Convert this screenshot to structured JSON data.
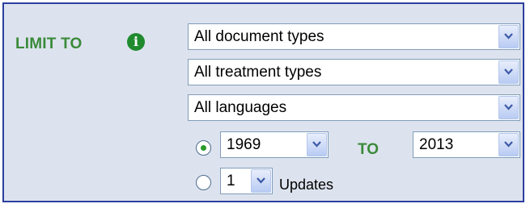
{
  "limit": {
    "label": "LIMIT TO",
    "info_icon": "info-icon",
    "info_glyph": "i"
  },
  "filters": {
    "document_type": "All document types",
    "treatment_type": "All treatment types",
    "language": "All languages"
  },
  "date_range": {
    "from_year": "1969",
    "to_label": "TO",
    "to_year": "2013",
    "selected": true
  },
  "updates": {
    "count": "1",
    "label": "Updates",
    "selected": false
  },
  "colors": {
    "accent_green": "#3a8a3a",
    "panel_border": "#2c3f9e",
    "panel_bg": "#dde3ee"
  }
}
